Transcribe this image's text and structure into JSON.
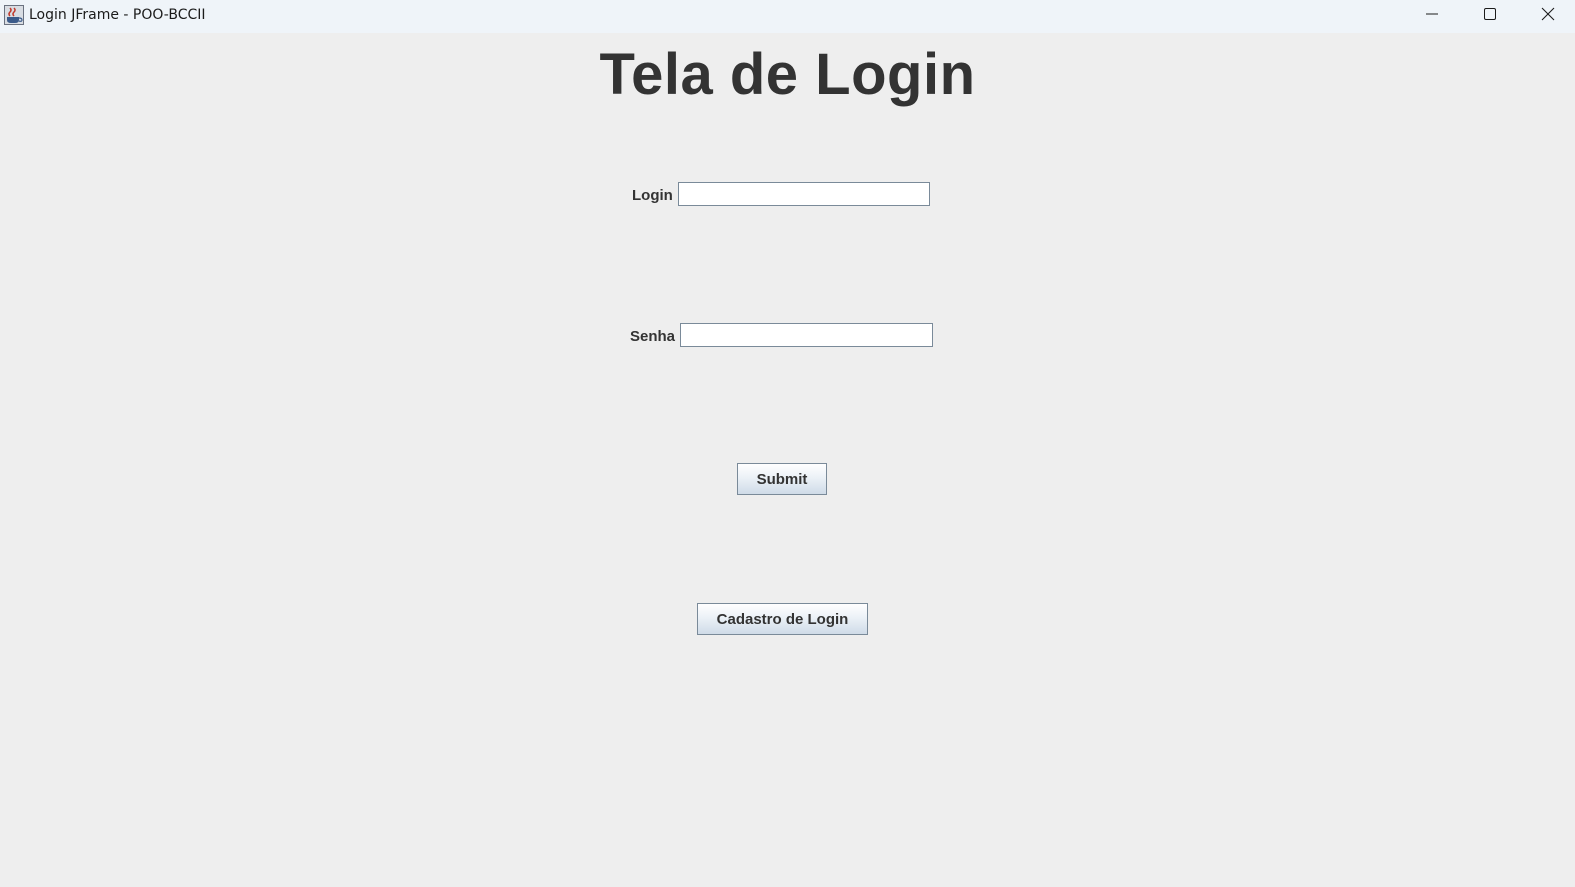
{
  "window": {
    "title": "Login JFrame - POO-BCCII",
    "app_icon": "java-coffee-icon",
    "controls": {
      "minimize": "minimize-icon",
      "maximize": "maximize-icon",
      "close": "close-icon"
    }
  },
  "form": {
    "heading": "Tela de Login",
    "login_label": "Login",
    "login_value": "",
    "password_label": "Senha",
    "password_value": "",
    "submit_label": "Submit",
    "register_label": "Cadastro de Login"
  },
  "colors": {
    "background": "#eeeeee",
    "titlebar": "#eff4f9",
    "text": "#333333",
    "field_border": "#7a8a99"
  }
}
